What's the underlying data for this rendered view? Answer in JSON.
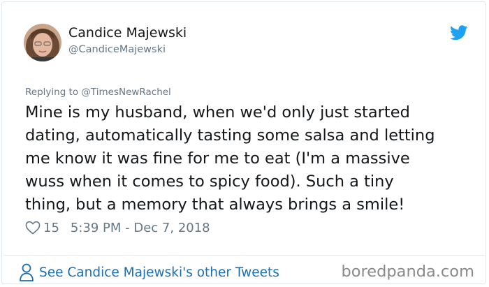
{
  "user": {
    "name": "Candice Majewski",
    "handle": "@CandiceMajewski"
  },
  "tweet": {
    "replying_to": "Replying to @TimesNewRachel",
    "lines": [
      "Mine is my husband, when we'd only just started",
      "dating, automatically tasting some salsa and letting",
      "me know it was fine for me to eat (I'm a massive",
      "wuss when it comes to spicy food).  Such a tiny",
      "thing, but a memory that always brings a smile!"
    ],
    "likes": "15",
    "timestamp": "5:39 PM - Dec 7, 2018"
  },
  "footer": {
    "other_tweets_link": "See Candice Majewski's other Tweets",
    "watermark": "boredpanda.com"
  },
  "icons": {
    "bird": "twitter-bird-icon",
    "heart": "heart-outline-icon",
    "person": "person-outline-icon"
  },
  "colors": {
    "twitter_blue": "#1da1f2",
    "link_blue": "#1b6fb0",
    "muted": "#657786",
    "text": "#14171a"
  }
}
